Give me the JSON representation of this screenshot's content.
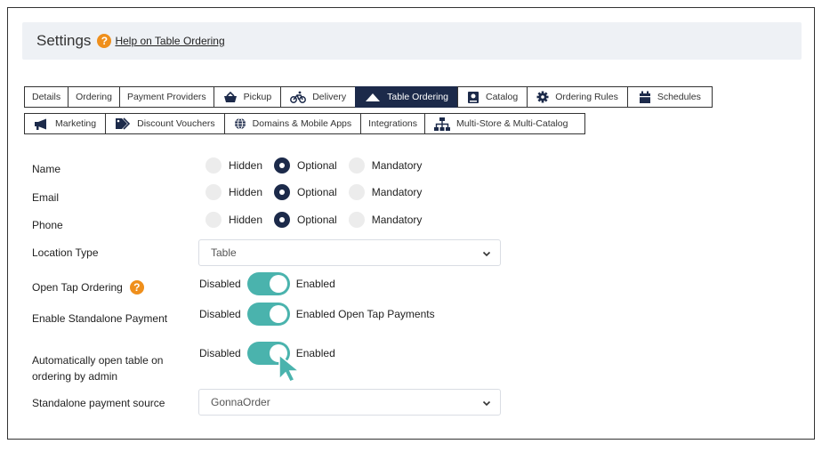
{
  "header": {
    "title": "Settings",
    "help_link": "Help on Table Ordering"
  },
  "tabs_row1": [
    {
      "label": "Details",
      "icon": "none"
    },
    {
      "label": "Ordering",
      "icon": "none"
    },
    {
      "label": "Payment Providers",
      "icon": "none"
    },
    {
      "label": "Pickup",
      "icon": "basket-icon"
    },
    {
      "label": "Delivery",
      "icon": "bicycle-icon"
    },
    {
      "label": "Table Ordering",
      "icon": "mountain-icon",
      "active": true
    },
    {
      "label": "Catalog",
      "icon": "book-icon"
    },
    {
      "label": "Ordering Rules",
      "icon": "gear-icon"
    },
    {
      "label": "Schedules",
      "icon": "calendar-icon"
    }
  ],
  "tabs_row2": [
    {
      "label": "Marketing",
      "icon": "megaphone-icon"
    },
    {
      "label": "Discount Vouchers",
      "icon": "tag-icon"
    },
    {
      "label": "Domains & Mobile Apps",
      "icon": "globe-icon"
    },
    {
      "label": "Integrations",
      "icon": "none"
    },
    {
      "label": "Multi-Store & Multi-Catalog",
      "icon": "sitemap-icon"
    }
  ],
  "form": {
    "name_label": "Name",
    "email_label": "Email",
    "phone_label": "Phone",
    "radio_options": {
      "hidden": "Hidden",
      "optional": "Optional",
      "mandatory": "Mandatory"
    },
    "name_selected": "Optional",
    "email_selected": "Optional",
    "phone_selected": "Optional",
    "location_type_label": "Location Type",
    "location_type_value": "Table",
    "open_tap_label": "Open Tap Ordering",
    "open_tap_off": "Disabled",
    "open_tap_on": "Enabled",
    "standalone_label": "Enable Standalone Payment",
    "standalone_off": "Disabled",
    "standalone_on": "Enabled Open Tap Payments",
    "auto_open_label": "Automatically open table on ordering by admin",
    "auto_open_off": "Disabled",
    "auto_open_on": "Enabled",
    "payment_source_label": "Standalone payment source",
    "payment_source_value": "GonnaOrder"
  },
  "colors": {
    "navy": "#1c2a4a",
    "teal": "#4ab3ad",
    "help_orange": "#ef8f1c",
    "header_bg": "#eef1f5"
  }
}
